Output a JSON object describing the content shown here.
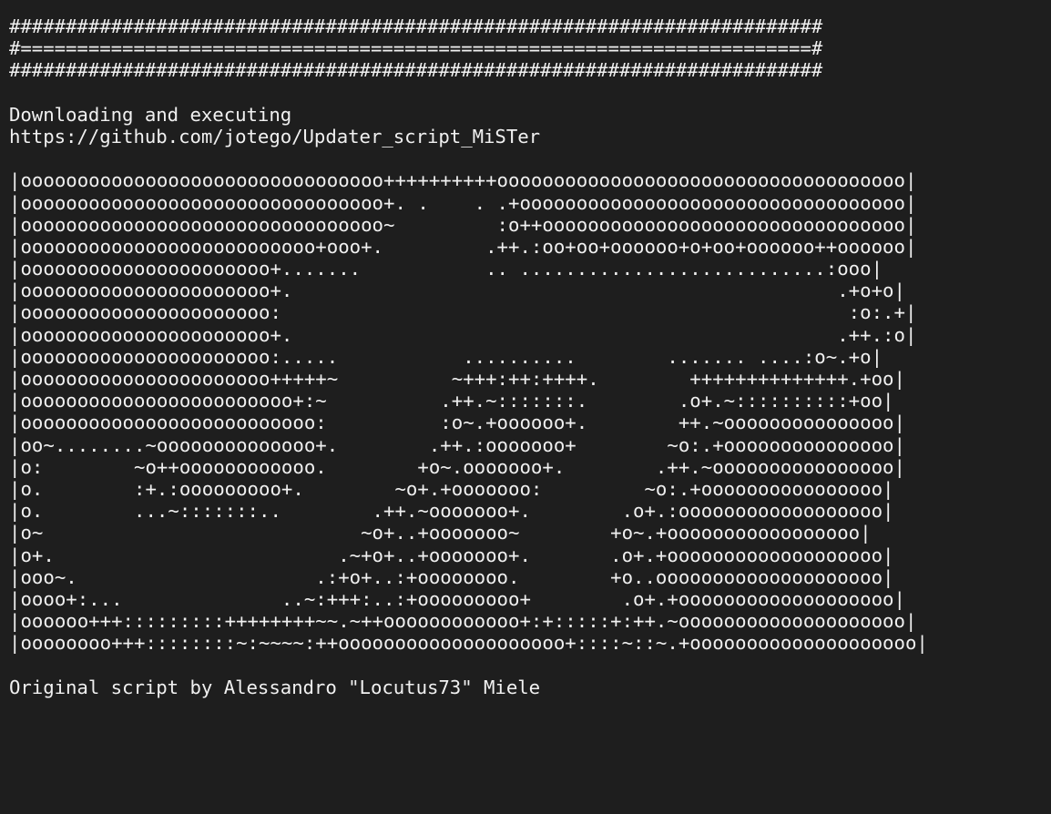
{
  "terminal": {
    "banner": [
      "########################################################################",
      "#======================================================================#",
      "########################################################################"
    ],
    "intro": [
      "Downloading and executing",
      "https://github.com/jotego/Updater_script_MiSTer"
    ],
    "ascii_art": [
      "|oooooooooooooooooooooooooooooooo++++++++++oooooooooooooooooooooooooooooooooooo|",
      "|oooooooooooooooooooooooooooooooo+. .    . .+oooooooooooooooooooooooooooooooooo|",
      "|oooooooooooooooooooooooooooooooo~         :o++oooooooooooooooooooooooooooooooo|",
      "|oooooooooooooooooooooooooo+ooo+.         .++.:oo+oo+oooooo+o+oo+oooooo++oooooo|",
      "|oooooooooooooooooooooo+.......           .. ...........................:ooo|",
      "|oooooooooooooooooooooo+.                                                .+o+o|",
      "|oooooooooooooooooooooo:                                                  :o:.+|",
      "|oooooooooooooooooooooo+.                                                .++.:o|",
      "|oooooooooooooooooooooo:.....           ..........        ....... ....:o~.+o|",
      "|oooooooooooooooooooooo+++++~          ~+++:++:++++.        ++++++++++++++.+oo|",
      "|oooooooooooooooooooooooo+:~          .++.~:::::::.        .o+.~::::::::::+oo|",
      "|oooooooooooooooooooooooooo:          :o~.+oooooo+.        ++.~ooooooooooooooo|",
      "|oo~........~oooooooooooooo+.        .++.:ooooooo+        ~o:.+ooooooooooooooo|",
      "|o:        ~o++oooooooooooo.        +o~.ooooooo+.        .++.~oooooooooooooooo|",
      "|o.        :+.:ooooooooo+.        ~o+.+ooooooo:         ~o:.+oooooooooooooooo|",
      "|o.        ...~:::::::..        .++.~ooooooo+.        .o+.:oooooooooooooooooo|",
      "|o~                            ~o+..+ooooooo~        +o~.+ooooooooooooooooo|",
      "|o+.                         .~+o+..+ooooooo+.       .o+.+ooooooooooooooooooo|",
      "|ooo~.                     .:+o+..:+oooooooo.        +o..oooooooooooooooooooo|",
      "|oooo+:...              ..~:+++:..:+ooooooooo+        .o+.+ooooooooooooooooooo|",
      "|oooooo+++:::::::::++++++++~~.~++oooooooooooo+:+:::::+:++.~oooooooooooooooooooo|",
      "|oooooooo+++::::::::~:~~~~:++oooooooooooooooooooo+::::~::~.+oooooooooooooooooooo|"
    ],
    "footer": "Original script by Alessandro \"Locutus73\" Miele",
    "colors": {
      "background": "#1e1e1e",
      "foreground": "#f0f0f0"
    }
  }
}
